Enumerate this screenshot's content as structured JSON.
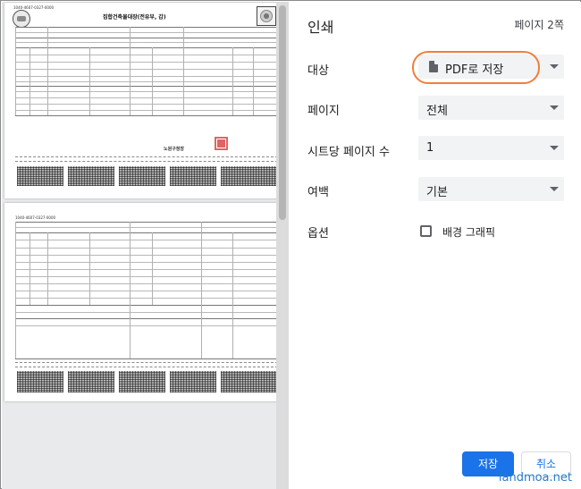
{
  "settings": {
    "title": "인쇄",
    "page_count": "페이지 2쪽",
    "rows": {
      "destination": {
        "label": "대상",
        "value": "PDF로 저장"
      },
      "pages": {
        "label": "페이지",
        "value": "전체"
      },
      "pages_per_sheet": {
        "label": "시트당 페이지 수",
        "value": "1"
      },
      "margins": {
        "label": "여백",
        "value": "기본"
      },
      "options": {
        "label": "옵션",
        "checkbox_label": "배경 그래픽"
      }
    },
    "buttons": {
      "save": "저장",
      "cancel": "취소"
    },
    "highlight_color": "#f07f3c",
    "accent": "#1a73e8"
  },
  "preview": {
    "page1": {
      "title": "집합건축물대장(전유부, 갑)",
      "form_no": "1040-4607-0327-0000",
      "authority": "노원구청장"
    },
    "page2": {
      "form_no": "1040-4607-0327-0000"
    }
  },
  "watermark": "landmoa.net"
}
